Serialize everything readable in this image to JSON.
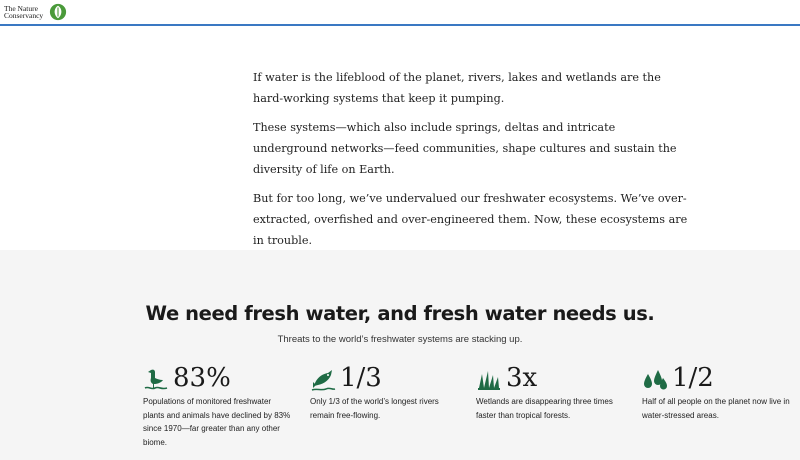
{
  "header": {
    "logo_line1": "The Nature",
    "logo_line2": "Conservancy",
    "accent_color": "#3a78c3",
    "logo_icon": "leaf-globe-icon"
  },
  "intro": {
    "paragraphs": [
      "If water is the lifeblood of the planet, rivers, lakes and wetlands are the hard-working systems that keep it pumping.",
      "These systems—which also include springs, deltas and intricate underground networks—feed communities, shape cultures and sustain the diversity of life on Earth.",
      "But for too long, we’ve undervalued our freshwater ecosystems. We’ve over-extracted, overfished and over-engineered them. Now, these ecosystems are in trouble."
    ]
  },
  "stats_section": {
    "heading": "We need fresh water, and fresh water needs us.",
    "subheading": "Threats to the world’s freshwater systems are stacking up.",
    "icon_color": "#1f6b45",
    "stats": [
      {
        "icon": "heron-icon",
        "value": "83%",
        "description": "Populations of monitored freshwater plants and animals have declined by 83% since 1970—far greater than any other biome."
      },
      {
        "icon": "fish-jumping-icon",
        "value": "1/3",
        "description": "Only 1/3 of the world’s longest rivers remain free-flowing."
      },
      {
        "icon": "grass-icon",
        "value": "3x",
        "description": "Wetlands are disappearing three times faster than tropical forests."
      },
      {
        "icon": "water-drops-icon",
        "value": "1/2",
        "description": "Half of all people on the planet now live in water-stressed areas."
      }
    ]
  }
}
